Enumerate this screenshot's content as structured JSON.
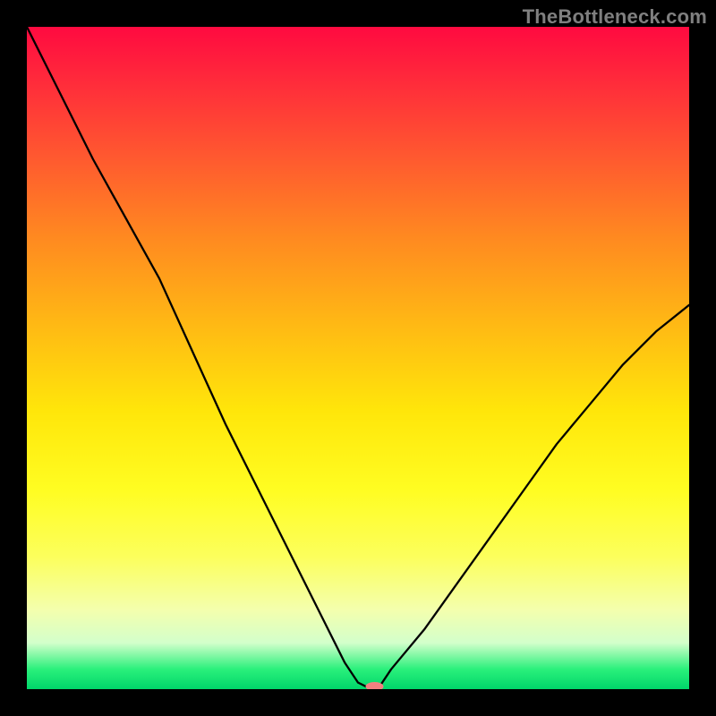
{
  "watermark": {
    "text": "TheBottleneck.com"
  },
  "chart_data": {
    "type": "line",
    "title": "",
    "xlabel": "",
    "ylabel": "",
    "xlim": [
      0,
      100
    ],
    "ylim": [
      0,
      100
    ],
    "grid": false,
    "legend": false,
    "series": [
      {
        "name": "bottleneck-curve",
        "x": [
          0,
          5,
          10,
          15,
          20,
          25,
          30,
          35,
          40,
          45,
          48,
          50,
          52,
          53,
          55,
          60,
          65,
          70,
          75,
          80,
          85,
          90,
          95,
          100
        ],
        "y": [
          100,
          90,
          80,
          71,
          62,
          51,
          40,
          30,
          20,
          10,
          4,
          1,
          0,
          0,
          3,
          9,
          16,
          23,
          30,
          37,
          43,
          49,
          54,
          58
        ]
      }
    ],
    "marker": {
      "x": 52.5,
      "y": 0,
      "color": "#f28080"
    },
    "background_gradient": {
      "stops": [
        {
          "pos": 0.0,
          "color": "#ff0a40"
        },
        {
          "pos": 0.2,
          "color": "#ff5a2f"
        },
        {
          "pos": 0.45,
          "color": "#ffb914"
        },
        {
          "pos": 0.7,
          "color": "#fffd22"
        },
        {
          "pos": 0.93,
          "color": "#d3ffcb"
        },
        {
          "pos": 1.0,
          "color": "#00d66a"
        }
      ]
    }
  }
}
